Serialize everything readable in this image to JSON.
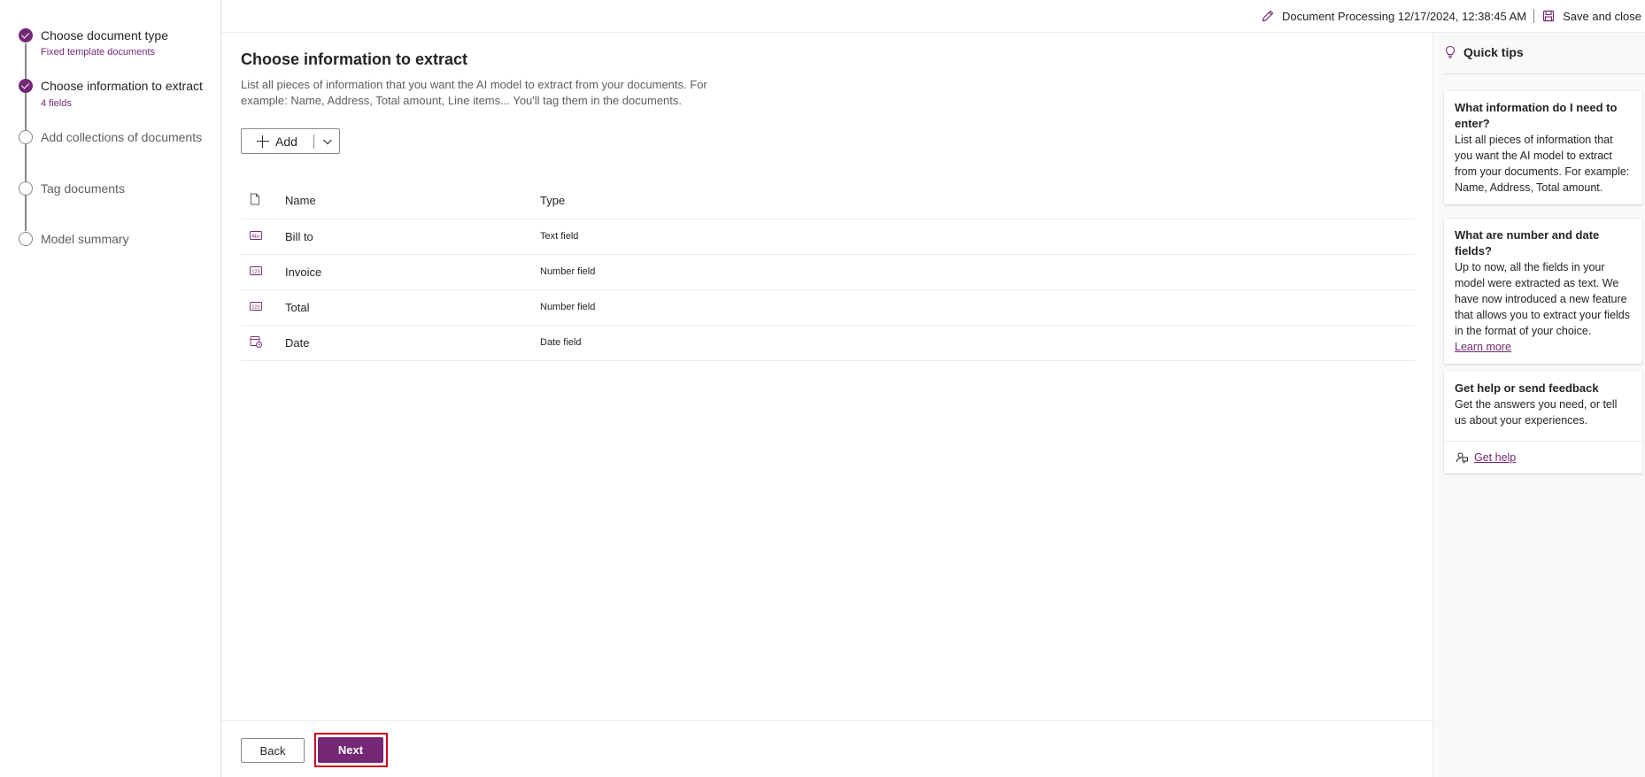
{
  "stepper": {
    "steps": [
      {
        "title": "Choose document type",
        "subtitle": "Fixed template documents",
        "status": "done"
      },
      {
        "title": "Choose information to extract",
        "subtitle": "4 fields",
        "status": "done"
      },
      {
        "title": "Add collections of documents",
        "subtitle": "",
        "status": "todo"
      },
      {
        "title": "Tag documents",
        "subtitle": "",
        "status": "todo"
      },
      {
        "title": "Model summary",
        "subtitle": "",
        "status": "todo"
      }
    ]
  },
  "topbar": {
    "model_name": "Document Processing 12/17/2024, 12:38:45 AM",
    "save_label": "Save and close"
  },
  "main": {
    "title": "Choose information to extract",
    "description": "List all pieces of information that you want the AI model to extract from your documents. For example: Name, Address, Total amount, Line items... You'll tag them in the documents.",
    "add_label": "Add",
    "table": {
      "headers": {
        "name": "Name",
        "type": "Type"
      },
      "rows": [
        {
          "name": "Bill to",
          "type": "Text field",
          "icon": "text-field-icon"
        },
        {
          "name": "Invoice",
          "type": "Number field",
          "icon": "number-field-icon"
        },
        {
          "name": "Total",
          "type": "Number field",
          "icon": "number-field-icon"
        },
        {
          "name": "Date",
          "type": "Date field",
          "icon": "date-field-icon"
        }
      ]
    }
  },
  "footer": {
    "back_label": "Back",
    "next_label": "Next"
  },
  "tips": {
    "header": "Quick tips",
    "cards": [
      {
        "title": "What information do I need to enter?",
        "text": "List all pieces of information that you want the AI model to extract from your documents. For example: Name, Address, Total amount."
      },
      {
        "title": "What are number and date fields?",
        "text": "Up to now, all the fields in your model were extracted as text. We have now introduced a new feature that allows you to extract your fields in the format of your choice.",
        "link": "Learn more"
      },
      {
        "title": "Get help or send feedback",
        "text": "Get the answers you need, or tell us about your experiences.",
        "link": "Get help"
      }
    ]
  },
  "colors": {
    "accent": "#742774",
    "highlight": "#d0021b"
  }
}
